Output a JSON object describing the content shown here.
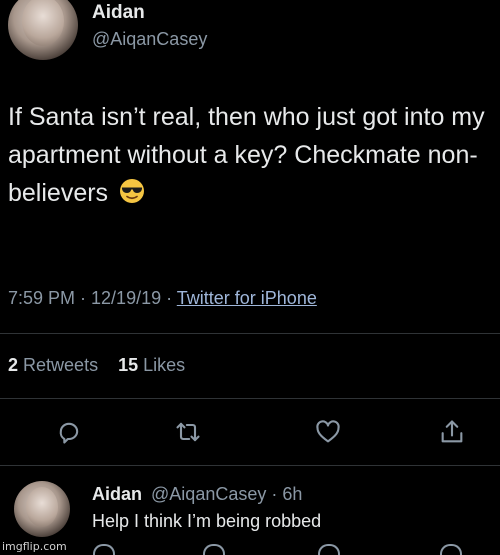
{
  "tweet": {
    "author": {
      "display_name": "Aidan",
      "handle": "@AiqanCasey"
    },
    "text": "If Santa isn’t real, then who just got into my apartment without a key? Checkmate non-believers",
    "emoji": "smiling-face-with-sunglasses",
    "time": "7:59 PM · 12/19/19 · ",
    "source": "Twitter for iPhone",
    "stats": {
      "retweets_count": "2",
      "retweets_label": "Retweets",
      "likes_count": "15",
      "likes_label": "Likes"
    },
    "actions": [
      "reply-icon",
      "retweet-icon",
      "like-icon",
      "share-icon"
    ]
  },
  "reply": {
    "display_name": "Aidan",
    "handle_time": "@AiqanCasey · 6h",
    "text": "Help I think I’m being robbed"
  },
  "watermark": "imgflip.com",
  "colors": {
    "background": "#000000",
    "primary_text": "#e7e9ea",
    "secondary_text": "#8b98a5",
    "divider": "#2f3336"
  }
}
